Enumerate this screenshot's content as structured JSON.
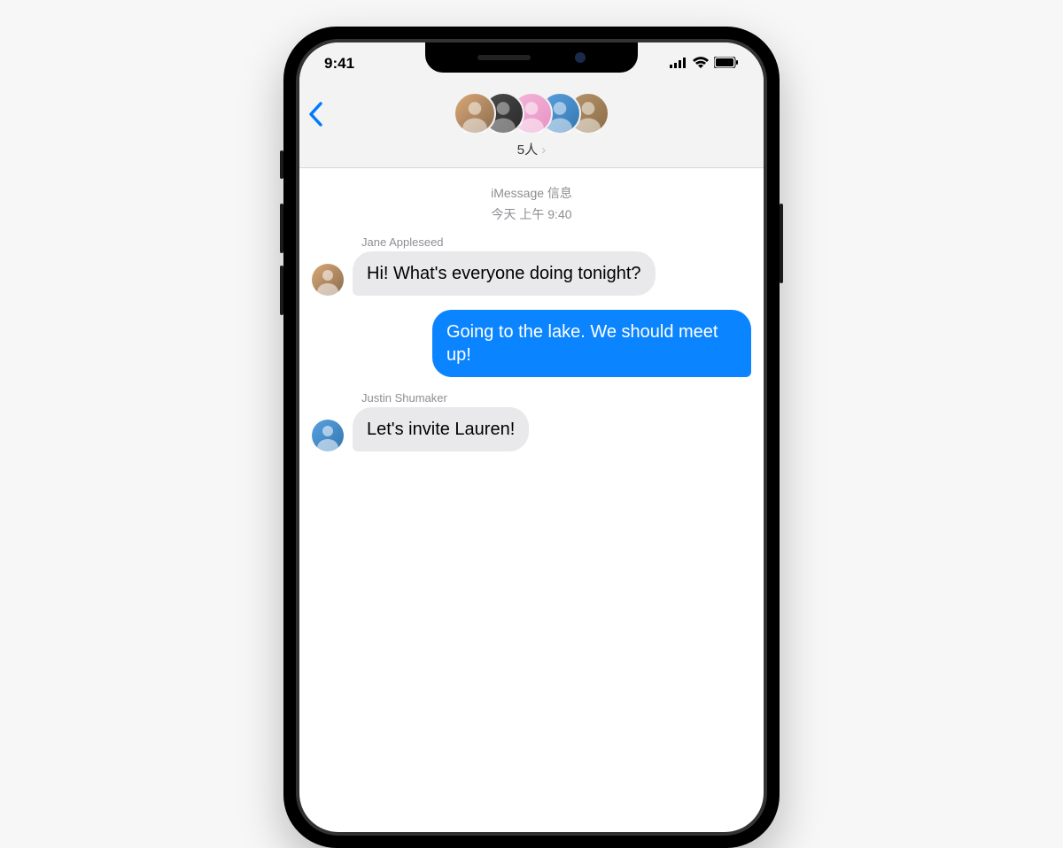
{
  "status_bar": {
    "time": "9:41"
  },
  "header": {
    "group_count_label": "5人",
    "avatar_count": 5
  },
  "thread": {
    "service_label": "iMessage 信息",
    "timestamp": "今天 上午 9:40"
  },
  "messages": [
    {
      "direction": "in",
      "sender": "Jane Appleseed",
      "text": "Hi! What's everyone doing tonight?"
    },
    {
      "direction": "out",
      "sender": "",
      "text": "Going to the lake. We should meet up!"
    },
    {
      "direction": "in",
      "sender": "Justin Shumaker",
      "text": "Let's invite Lauren!"
    }
  ]
}
